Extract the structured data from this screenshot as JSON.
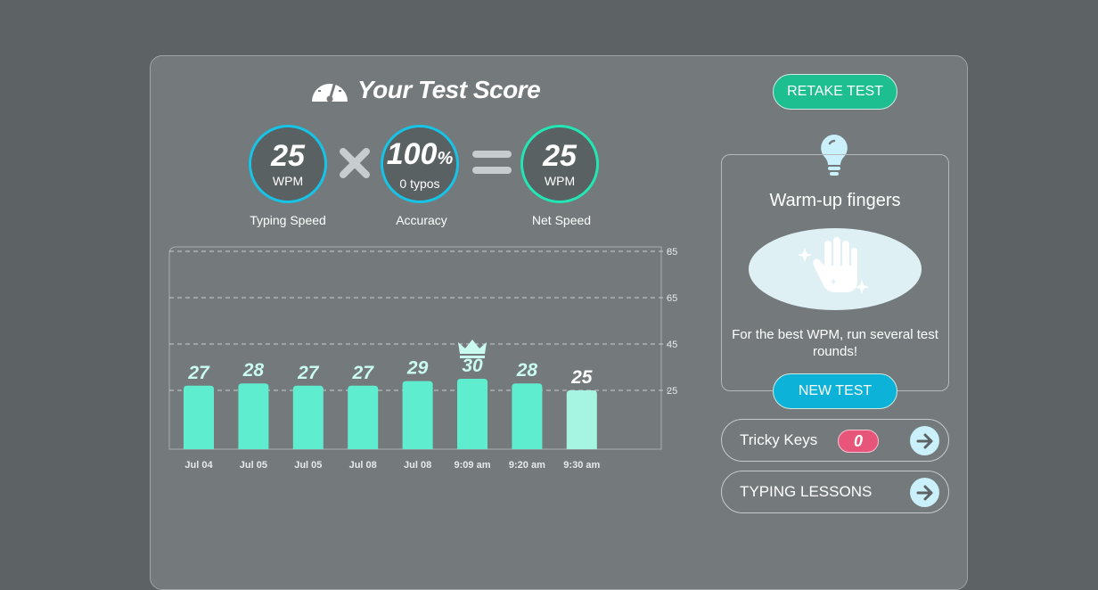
{
  "header": {
    "title": "Your Test Score",
    "icon": "speedometer-icon"
  },
  "stats": {
    "typing_speed": {
      "value": "25",
      "unit": "WPM",
      "label": "Typing Speed"
    },
    "accuracy": {
      "value": "100",
      "suffix": "%",
      "sub": "0 typos",
      "label": "Accuracy"
    },
    "net_speed": {
      "value": "25",
      "unit": "WPM",
      "label": "Net Speed"
    },
    "multiply_icon": "multiply-icon",
    "equals_icon": "equals-icon"
  },
  "actions": {
    "retake_label": "RETAKE TEST",
    "new_test_label": "NEW TEST"
  },
  "tip": {
    "title": "Warm-up fingers",
    "text": "For the best WPM, run several test rounds!",
    "icon": "lightbulb-icon",
    "image": "sparkling-hand-icon"
  },
  "links": {
    "tricky_keys_label": "Tricky Keys",
    "tricky_keys_count": "0",
    "typing_lessons_label": "TYPING LESSONS"
  },
  "colors": {
    "accent_blue": "#16c4e8",
    "accent_green": "#22e6b4",
    "retake_button": "#1dbf91",
    "new_test_button": "#0cb2d8",
    "bar": "#5fedcf",
    "bar_current": "#a6f5e3",
    "badge": "#e8557a"
  },
  "chart_data": {
    "type": "bar",
    "categories": [
      "Jul 04",
      "Jul 05",
      "Jul 05",
      "Jul 08",
      "Jul 08",
      "9:09 am",
      "9:20 am",
      "9:30 am"
    ],
    "values": [
      27,
      28,
      27,
      27,
      29,
      30,
      28,
      25
    ],
    "yticks": [
      25,
      45,
      65,
      85
    ],
    "ylim": [
      0,
      85
    ],
    "grid": true,
    "best_index": 5,
    "best_icon": "crown-icon",
    "current_index": 7
  }
}
